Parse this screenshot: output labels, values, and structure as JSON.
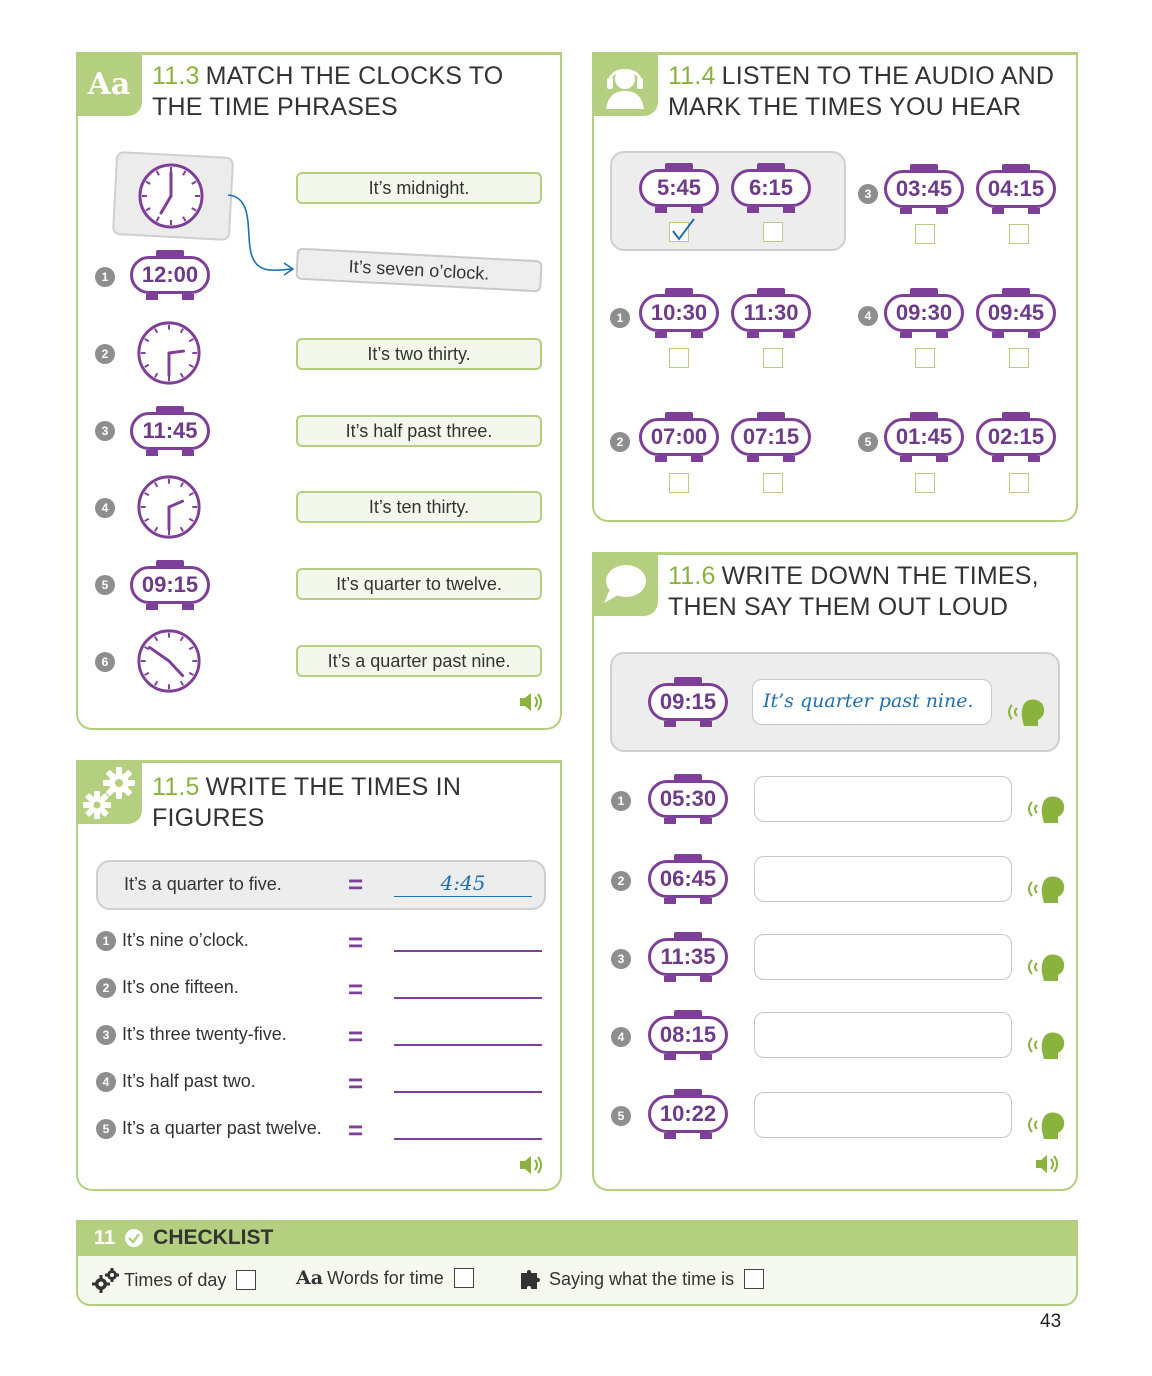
{
  "ex113": {
    "num": "11.3",
    "title_l1": "MATCH THE CLOCKS TO",
    "title_l2": "THE TIME PHRASES",
    "tab_text": "Aa",
    "example_phrase": "It’s seven o’clock.",
    "items": [
      {
        "n": "1",
        "kind": "digital",
        "time": "12:00"
      },
      {
        "n": "2",
        "kind": "analog"
      },
      {
        "n": "3",
        "kind": "digital",
        "time": "11:45"
      },
      {
        "n": "4",
        "kind": "analog"
      },
      {
        "n": "5",
        "kind": "digital",
        "time": "09:15"
      },
      {
        "n": "6",
        "kind": "analog"
      }
    ],
    "phrases": [
      "It’s midnight.",
      "It’s two thirty.",
      "It’s half past three.",
      "It’s ten thirty.",
      "It’s quarter to twelve.",
      "It’s a quarter past nine."
    ]
  },
  "ex114": {
    "num": "11.4",
    "title_l1": "LISTEN TO THE AUDIO AND",
    "title_l2": "MARK THE TIMES YOU HEAR",
    "example": {
      "a": "5:45",
      "b": "6:15",
      "checked": "a"
    },
    "items": [
      {
        "n": "3",
        "a": "03:45",
        "b": "04:15"
      },
      {
        "n": "1",
        "a": "10:30",
        "b": "11:30"
      },
      {
        "n": "4",
        "a": "09:30",
        "b": "09:45"
      },
      {
        "n": "2",
        "a": "07:00",
        "b": "07:15"
      },
      {
        "n": "5",
        "a": "01:45",
        "b": "02:15"
      }
    ]
  },
  "ex115": {
    "num": "11.5",
    "title": "WRITE THE TIMES IN FIGURES",
    "example": {
      "text": "It’s a quarter to five.",
      "answer": "4:45"
    },
    "eq": "=",
    "items": [
      {
        "n": "1",
        "text": "It’s nine o’clock."
      },
      {
        "n": "2",
        "text": "It’s one fifteen."
      },
      {
        "n": "3",
        "text": "It’s three twenty-five."
      },
      {
        "n": "4",
        "text": "It’s half past two."
      },
      {
        "n": "5",
        "text": "It’s a quarter past twelve."
      }
    ]
  },
  "ex116": {
    "num": "11.6",
    "title_l1": "WRITE DOWN THE TIMES,",
    "title_l2": "THEN SAY THEM OUT LOUD",
    "example": {
      "time": "09:15",
      "answer": "It’s quarter past nine."
    },
    "items": [
      {
        "n": "1",
        "time": "05:30"
      },
      {
        "n": "2",
        "time": "06:45"
      },
      {
        "n": "3",
        "time": "11:35"
      },
      {
        "n": "4",
        "time": "08:15"
      },
      {
        "n": "5",
        "time": "10:22"
      }
    ]
  },
  "checklist": {
    "num": "11",
    "title": "CHECKLIST",
    "items": [
      {
        "label": "Times of day",
        "icon": "gears-icon"
      },
      {
        "label": "Words for time",
        "icon": "aa-icon",
        "prefix": "Aa"
      },
      {
        "label": "Saying what the time is",
        "icon": "puzzle-icon"
      }
    ]
  },
  "page_number": "43",
  "colors": {
    "green": "#b3cf7f",
    "green_text": "#8ab33d",
    "purple": "#7d3f98",
    "blue": "#1f6fb5"
  }
}
